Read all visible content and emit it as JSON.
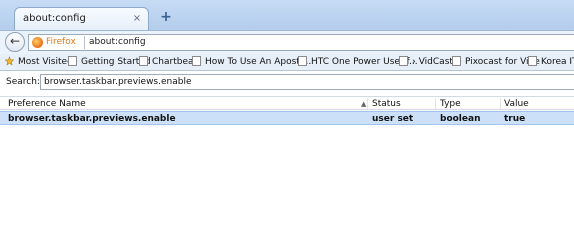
{
  "tab": {
    "title": "about:config",
    "close_glyph": "×",
    "new_tab_glyph": "+"
  },
  "navbar": {
    "back_glyph": "←",
    "identity_label": "Firefox",
    "url": "about:config"
  },
  "bookmarks": [
    {
      "label": "Most Visited",
      "icon": "star-icon"
    },
    {
      "label": "Getting Started",
      "icon": "page-icon"
    },
    {
      "label": "Chartbeat",
      "icon": "page-icon"
    },
    {
      "label": "How To Use An Apostr...",
      "icon": "page-icon"
    },
    {
      "label": "HTC One Power User f...",
      "icon": "page-icon"
    },
    {
      "label": "VidCast",
      "icon": "chevron-icon"
    },
    {
      "label": "Pixocast for Vine",
      "icon": "page-icon"
    },
    {
      "label": "Korea IT N",
      "icon": "page-icon"
    }
  ],
  "search": {
    "label": "Search:",
    "value": "browser.taskbar.previews.enable"
  },
  "table": {
    "columns": [
      "Preference Name",
      "Status",
      "Type",
      "Value"
    ],
    "sort_glyph": "▲",
    "rows": [
      {
        "name": "browser.taskbar.previews.enable",
        "status": "user set",
        "type": "boolean",
        "value": "true"
      }
    ]
  },
  "colors": {
    "accent": "#e07a1e",
    "selection": "#cce1f7",
    "chrome": "#bcd3ee"
  }
}
